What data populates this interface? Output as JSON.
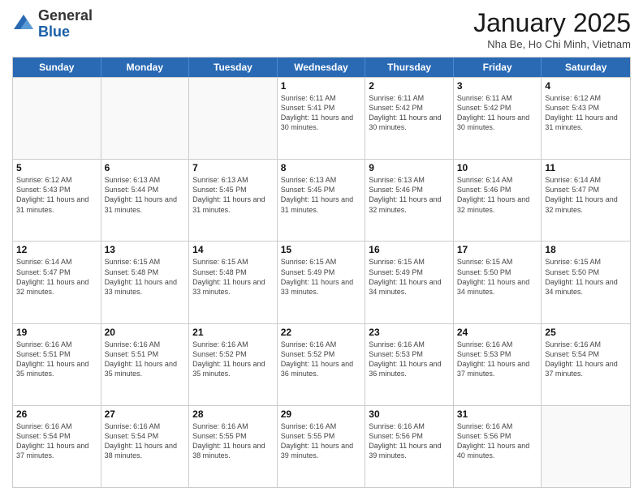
{
  "header": {
    "logo_general": "General",
    "logo_blue": "Blue",
    "month_title": "January 2025",
    "subtitle": "Nha Be, Ho Chi Minh, Vietnam"
  },
  "weekdays": [
    "Sunday",
    "Monday",
    "Tuesday",
    "Wednesday",
    "Thursday",
    "Friday",
    "Saturday"
  ],
  "weeks": [
    [
      {
        "day": "",
        "sunrise": "",
        "sunset": "",
        "daylight": "",
        "empty": true
      },
      {
        "day": "",
        "sunrise": "",
        "sunset": "",
        "daylight": "",
        "empty": true
      },
      {
        "day": "",
        "sunrise": "",
        "sunset": "",
        "daylight": "",
        "empty": true
      },
      {
        "day": "1",
        "sunrise": "Sunrise: 6:11 AM",
        "sunset": "Sunset: 5:41 PM",
        "daylight": "Daylight: 11 hours and 30 minutes.",
        "empty": false
      },
      {
        "day": "2",
        "sunrise": "Sunrise: 6:11 AM",
        "sunset": "Sunset: 5:42 PM",
        "daylight": "Daylight: 11 hours and 30 minutes.",
        "empty": false
      },
      {
        "day": "3",
        "sunrise": "Sunrise: 6:11 AM",
        "sunset": "Sunset: 5:42 PM",
        "daylight": "Daylight: 11 hours and 30 minutes.",
        "empty": false
      },
      {
        "day": "4",
        "sunrise": "Sunrise: 6:12 AM",
        "sunset": "Sunset: 5:43 PM",
        "daylight": "Daylight: 11 hours and 31 minutes.",
        "empty": false
      }
    ],
    [
      {
        "day": "5",
        "sunrise": "Sunrise: 6:12 AM",
        "sunset": "Sunset: 5:43 PM",
        "daylight": "Daylight: 11 hours and 31 minutes.",
        "empty": false
      },
      {
        "day": "6",
        "sunrise": "Sunrise: 6:13 AM",
        "sunset": "Sunset: 5:44 PM",
        "daylight": "Daylight: 11 hours and 31 minutes.",
        "empty": false
      },
      {
        "day": "7",
        "sunrise": "Sunrise: 6:13 AM",
        "sunset": "Sunset: 5:45 PM",
        "daylight": "Daylight: 11 hours and 31 minutes.",
        "empty": false
      },
      {
        "day": "8",
        "sunrise": "Sunrise: 6:13 AM",
        "sunset": "Sunset: 5:45 PM",
        "daylight": "Daylight: 11 hours and 31 minutes.",
        "empty": false
      },
      {
        "day": "9",
        "sunrise": "Sunrise: 6:13 AM",
        "sunset": "Sunset: 5:46 PM",
        "daylight": "Daylight: 11 hours and 32 minutes.",
        "empty": false
      },
      {
        "day": "10",
        "sunrise": "Sunrise: 6:14 AM",
        "sunset": "Sunset: 5:46 PM",
        "daylight": "Daylight: 11 hours and 32 minutes.",
        "empty": false
      },
      {
        "day": "11",
        "sunrise": "Sunrise: 6:14 AM",
        "sunset": "Sunset: 5:47 PM",
        "daylight": "Daylight: 11 hours and 32 minutes.",
        "empty": false
      }
    ],
    [
      {
        "day": "12",
        "sunrise": "Sunrise: 6:14 AM",
        "sunset": "Sunset: 5:47 PM",
        "daylight": "Daylight: 11 hours and 32 minutes.",
        "empty": false
      },
      {
        "day": "13",
        "sunrise": "Sunrise: 6:15 AM",
        "sunset": "Sunset: 5:48 PM",
        "daylight": "Daylight: 11 hours and 33 minutes.",
        "empty": false
      },
      {
        "day": "14",
        "sunrise": "Sunrise: 6:15 AM",
        "sunset": "Sunset: 5:48 PM",
        "daylight": "Daylight: 11 hours and 33 minutes.",
        "empty": false
      },
      {
        "day": "15",
        "sunrise": "Sunrise: 6:15 AM",
        "sunset": "Sunset: 5:49 PM",
        "daylight": "Daylight: 11 hours and 33 minutes.",
        "empty": false
      },
      {
        "day": "16",
        "sunrise": "Sunrise: 6:15 AM",
        "sunset": "Sunset: 5:49 PM",
        "daylight": "Daylight: 11 hours and 34 minutes.",
        "empty": false
      },
      {
        "day": "17",
        "sunrise": "Sunrise: 6:15 AM",
        "sunset": "Sunset: 5:50 PM",
        "daylight": "Daylight: 11 hours and 34 minutes.",
        "empty": false
      },
      {
        "day": "18",
        "sunrise": "Sunrise: 6:15 AM",
        "sunset": "Sunset: 5:50 PM",
        "daylight": "Daylight: 11 hours and 34 minutes.",
        "empty": false
      }
    ],
    [
      {
        "day": "19",
        "sunrise": "Sunrise: 6:16 AM",
        "sunset": "Sunset: 5:51 PM",
        "daylight": "Daylight: 11 hours and 35 minutes.",
        "empty": false
      },
      {
        "day": "20",
        "sunrise": "Sunrise: 6:16 AM",
        "sunset": "Sunset: 5:51 PM",
        "daylight": "Daylight: 11 hours and 35 minutes.",
        "empty": false
      },
      {
        "day": "21",
        "sunrise": "Sunrise: 6:16 AM",
        "sunset": "Sunset: 5:52 PM",
        "daylight": "Daylight: 11 hours and 35 minutes.",
        "empty": false
      },
      {
        "day": "22",
        "sunrise": "Sunrise: 6:16 AM",
        "sunset": "Sunset: 5:52 PM",
        "daylight": "Daylight: 11 hours and 36 minutes.",
        "empty": false
      },
      {
        "day": "23",
        "sunrise": "Sunrise: 6:16 AM",
        "sunset": "Sunset: 5:53 PM",
        "daylight": "Daylight: 11 hours and 36 minutes.",
        "empty": false
      },
      {
        "day": "24",
        "sunrise": "Sunrise: 6:16 AM",
        "sunset": "Sunset: 5:53 PM",
        "daylight": "Daylight: 11 hours and 37 minutes.",
        "empty": false
      },
      {
        "day": "25",
        "sunrise": "Sunrise: 6:16 AM",
        "sunset": "Sunset: 5:54 PM",
        "daylight": "Daylight: 11 hours and 37 minutes.",
        "empty": false
      }
    ],
    [
      {
        "day": "26",
        "sunrise": "Sunrise: 6:16 AM",
        "sunset": "Sunset: 5:54 PM",
        "daylight": "Daylight: 11 hours and 37 minutes.",
        "empty": false
      },
      {
        "day": "27",
        "sunrise": "Sunrise: 6:16 AM",
        "sunset": "Sunset: 5:54 PM",
        "daylight": "Daylight: 11 hours and 38 minutes.",
        "empty": false
      },
      {
        "day": "28",
        "sunrise": "Sunrise: 6:16 AM",
        "sunset": "Sunset: 5:55 PM",
        "daylight": "Daylight: 11 hours and 38 minutes.",
        "empty": false
      },
      {
        "day": "29",
        "sunrise": "Sunrise: 6:16 AM",
        "sunset": "Sunset: 5:55 PM",
        "daylight": "Daylight: 11 hours and 39 minutes.",
        "empty": false
      },
      {
        "day": "30",
        "sunrise": "Sunrise: 6:16 AM",
        "sunset": "Sunset: 5:56 PM",
        "daylight": "Daylight: 11 hours and 39 minutes.",
        "empty": false
      },
      {
        "day": "31",
        "sunrise": "Sunrise: 6:16 AM",
        "sunset": "Sunset: 5:56 PM",
        "daylight": "Daylight: 11 hours and 40 minutes.",
        "empty": false
      },
      {
        "day": "",
        "sunrise": "",
        "sunset": "",
        "daylight": "",
        "empty": true
      }
    ]
  ]
}
